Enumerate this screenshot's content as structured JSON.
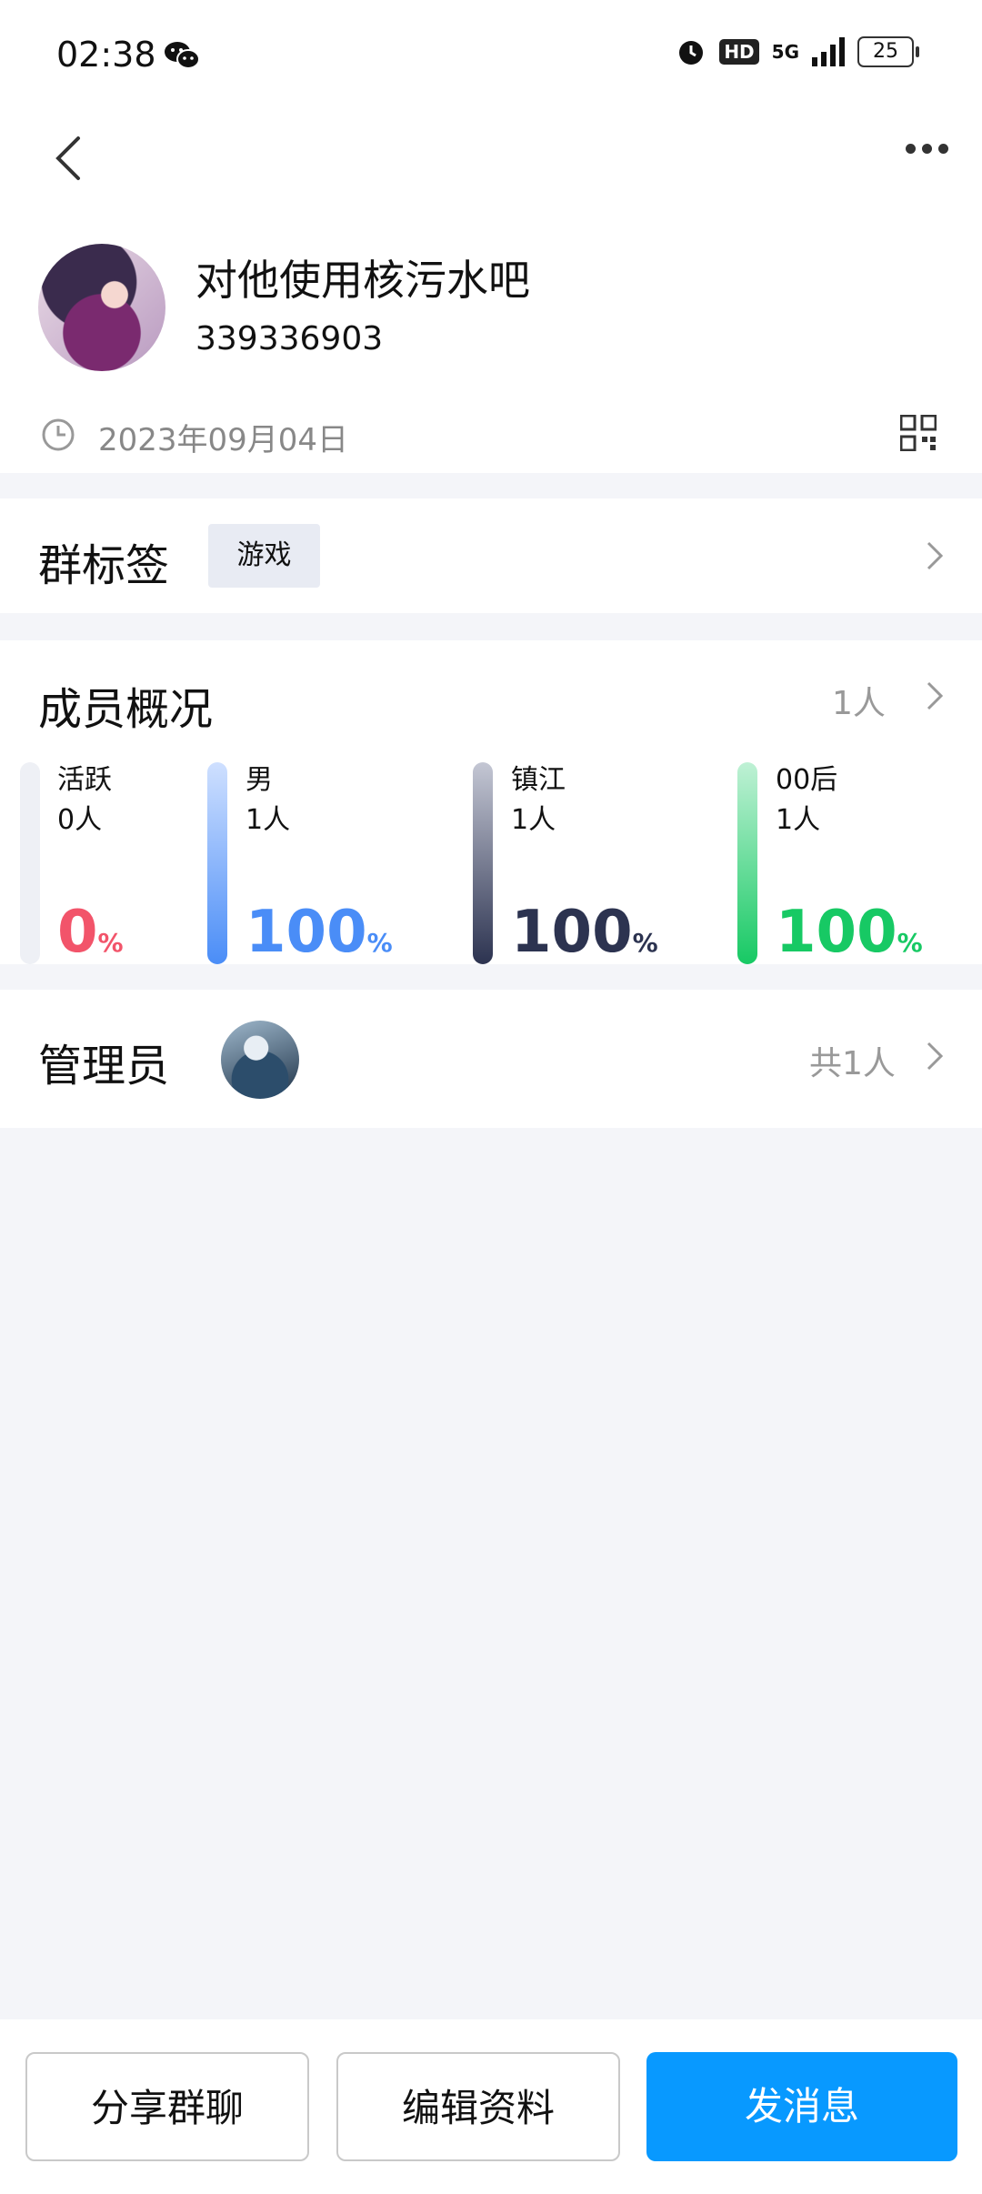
{
  "status": {
    "time": "02:38",
    "hd": "HD",
    "signal": "5G",
    "battery": "25"
  },
  "group": {
    "name": "对他使用核污水吧",
    "id": "339336903",
    "date": "2023年09月04日"
  },
  "tags": {
    "label": "群标签",
    "chip": "游戏"
  },
  "members": {
    "label": "成员概况",
    "count": "1人",
    "stats": [
      {
        "title": "活跃",
        "count": "0人",
        "percent": "0",
        "unit": "%",
        "color": "#f2546a"
      },
      {
        "title": "男",
        "count": "1人",
        "percent": "100",
        "unit": "%",
        "color": "#4a8df7"
      },
      {
        "title": "镇江",
        "count": "1人",
        "percent": "100",
        "unit": "%",
        "color": "#2c3350"
      },
      {
        "title": "00后",
        "count": "1人",
        "percent": "100",
        "unit": "%",
        "color": "#17c964"
      }
    ]
  },
  "admins": {
    "label": "管理员",
    "total": "共1人"
  },
  "actions": {
    "share": "分享群聊",
    "edit": "编辑资料",
    "message": "发消息"
  }
}
